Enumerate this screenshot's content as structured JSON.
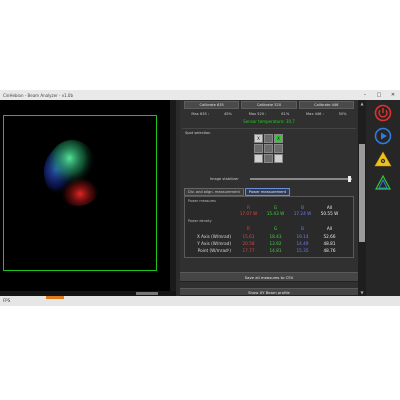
{
  "window": {
    "title": "CinHebion - Beam Analyzer - v1.0b"
  },
  "calibrate": {
    "buttons": [
      {
        "label": "Calibrate 635"
      },
      {
        "label": "Calibrate 520"
      },
      {
        "label": "Calibrate 446"
      }
    ]
  },
  "max": [
    {
      "label": "Max 635 :",
      "value": "45%"
    },
    {
      "label": "Max 520 :",
      "value": "61%"
    },
    {
      "label": "Max 446 :",
      "value": "50%"
    }
  ],
  "sensor": {
    "text": "Sensor temperature: 30.7"
  },
  "spot": {
    "label": "Spot selection",
    "cells": [
      "X",
      "",
      "X",
      "",
      "",
      "",
      "",
      "",
      ""
    ]
  },
  "stabilizer": {
    "label": "Image stabilizer",
    "value": 1.0
  },
  "tabs": [
    {
      "label": "Div. and align. measurement"
    },
    {
      "label": "Power measurement"
    }
  ],
  "power_measure": {
    "title": "Power measures",
    "headers": [
      "R",
      "G",
      "B",
      "All"
    ],
    "values": [
      "17.07 W",
      "15.43 W",
      "17.24 W",
      "50.55 W"
    ]
  },
  "power_density": {
    "title": "Power density",
    "headers": [
      "R",
      "G",
      "B",
      "All"
    ],
    "rows": [
      {
        "label": "X Axis (W/mrad)",
        "values": [
          "15.61",
          "18.43",
          "19.14",
          "52.66"
        ]
      },
      {
        "label": "Y Axis (W/mrad)",
        "values": [
          "20.58",
          "13.92",
          "14.49",
          "48.81"
        ]
      },
      {
        "label": "Point (W/mrad²)",
        "values": [
          "17.77",
          "14.81",
          "15.35",
          "48.76"
        ]
      }
    ]
  },
  "actions": {
    "save": "Save all measures to CSV",
    "profile": "Show XY Beam profile"
  },
  "status": {
    "text": "FPS"
  },
  "colors": {
    "roi": "#19c419",
    "accent_red": "#e04545",
    "accent_green": "#3fd43f",
    "accent_blue": "#6f7fea"
  },
  "icons": [
    "power-icon",
    "play-icon",
    "warning-icon",
    "logo-icon"
  ]
}
